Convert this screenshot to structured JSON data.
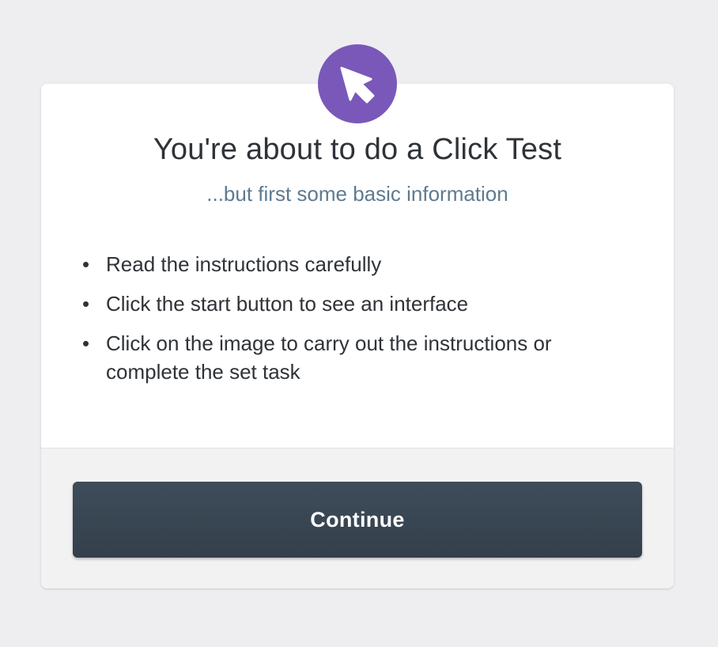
{
  "header": {
    "icon": "cursor-icon",
    "title": "You're about to do a Click Test",
    "subtitle": "...but first some basic information"
  },
  "instructions": {
    "items": [
      "Read the instructions carefully",
      "Click the start button to see an interface",
      "Click on the image to carry out the instructions or complete the set task"
    ]
  },
  "footer": {
    "continue_label": "Continue"
  },
  "colors": {
    "accent": "#7a58ba",
    "subtitle": "#5e7a90",
    "button": "#3a4753",
    "background": "#eeeef1"
  }
}
